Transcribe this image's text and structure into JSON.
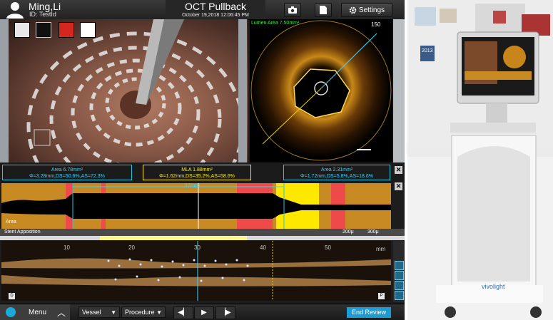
{
  "patient": {
    "name": "Ming,Li",
    "id": "ID: TestId"
  },
  "app": {
    "title": "OCT Pullback",
    "date": "October 19,2018 12:06:45 PM"
  },
  "toolbar": {
    "settings_label": "Settings"
  },
  "oct_view": {
    "lumen_area": "Lumen Area  7.50mm²",
    "frame": "150"
  },
  "measurements": {
    "left": {
      "title": "Area 6.78mm²",
      "detail": "Φ=3.28mm,DS=50.6%,AS=72.3%"
    },
    "mid": {
      "title": "MLA 1.88mm²",
      "detail": "Φ=1.62mm,DS=35.2%,AS=58.6%"
    },
    "right": {
      "title": "Area 2.31mm²",
      "detail": "Φ=1.72mm,DS=5.8%,AS=18.6%"
    }
  },
  "area_graph": {
    "label": "Area",
    "length": "37mm"
  },
  "stent": {
    "label": "Stent Apposition",
    "legend_a": "200μ",
    "legend_b": "300μ"
  },
  "long_view": {
    "ticks": [
      "10",
      "20",
      "30",
      "40",
      "50"
    ],
    "unit": "mm",
    "left_marker": "D",
    "right_marker": "P"
  },
  "bottom": {
    "menu": "Menu",
    "vessel": "Vessel",
    "procedure": "Procedure",
    "end_review": "End Review"
  },
  "photo": {
    "brand": "vivolight",
    "year": "2013"
  },
  "colors": {
    "accent": "#1b9cd4",
    "cyan": "#3ad4ff",
    "yellow": "#fff200",
    "lumen_green": "#2ff03a"
  }
}
